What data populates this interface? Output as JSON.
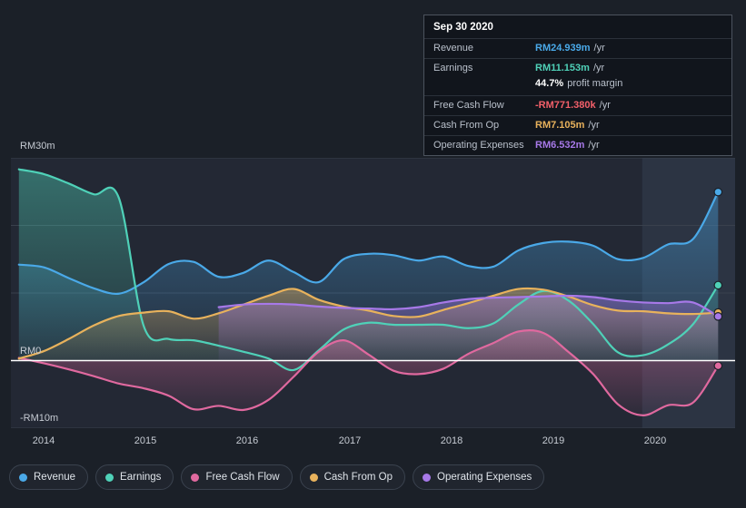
{
  "chart_data": {
    "type": "area",
    "title": "",
    "xlabel": "",
    "ylabel": "",
    "currency": "RM",
    "ylim": [
      -10,
      30
    ],
    "y_ticks": [
      {
        "value": 30,
        "label": "RM30m"
      },
      {
        "value": 20,
        "label": ""
      },
      {
        "value": 10,
        "label": ""
      },
      {
        "value": 0,
        "label": "RM0"
      },
      {
        "value": -10,
        "label": "-RM10m"
      }
    ],
    "x_ticks": [
      "2014",
      "2015",
      "2016",
      "2017",
      "2018",
      "2019",
      "2020"
    ],
    "xlim": [
      2013.7,
      2020.95
    ],
    "grid": true,
    "legend_position": "bottom",
    "series": [
      {
        "name": "Revenue",
        "color": "#4aa9e8",
        "x": [
          2013.78,
          2014.03,
          2014.28,
          2014.53,
          2014.78,
          2015.03,
          2015.28,
          2015.53,
          2015.78,
          2016.03,
          2016.28,
          2016.53,
          2016.78,
          2017.03,
          2017.28,
          2017.53,
          2017.78,
          2018.03,
          2018.28,
          2018.53,
          2018.78,
          2019.03,
          2019.28,
          2019.53,
          2019.78,
          2020.03,
          2020.28,
          2020.53,
          2020.78
        ],
        "values": [
          14.2,
          13.8,
          12.2,
          10.7,
          9.9,
          11.6,
          14.3,
          14.6,
          12.4,
          13.0,
          14.8,
          13.1,
          11.6,
          15.0,
          15.8,
          15.6,
          14.8,
          15.4,
          14.0,
          13.9,
          16.3,
          17.4,
          17.6,
          17.0,
          15.0,
          15.2,
          17.2,
          18.0,
          24.939
        ]
      },
      {
        "name": "Earnings",
        "color": "#4fd1b8",
        "x": [
          2013.78,
          2014.03,
          2014.28,
          2014.53,
          2014.78,
          2015.03,
          2015.28,
          2015.53,
          2015.78,
          2016.03,
          2016.28,
          2016.53,
          2016.78,
          2017.03,
          2017.28,
          2017.53,
          2017.78,
          2018.03,
          2018.28,
          2018.53,
          2018.78,
          2019.03,
          2019.28,
          2019.53,
          2019.78,
          2020.03,
          2020.28,
          2020.53,
          2020.78
        ],
        "values": [
          28.3,
          27.6,
          26.2,
          24.6,
          24.1,
          5.1,
          3.2,
          3.0,
          2.2,
          1.3,
          0.3,
          -1.4,
          1.5,
          4.6,
          5.6,
          5.3,
          5.3,
          5.3,
          4.8,
          5.5,
          8.3,
          10.3,
          8.9,
          5.4,
          1.2,
          0.8,
          2.4,
          5.4,
          11.153
        ]
      },
      {
        "name": "Free Cash Flow",
        "color": "#e0699f",
        "x": [
          2013.78,
          2014.03,
          2014.28,
          2014.53,
          2014.78,
          2015.03,
          2015.28,
          2015.53,
          2015.78,
          2016.03,
          2016.28,
          2016.53,
          2016.78,
          2017.03,
          2017.28,
          2017.53,
          2017.78,
          2018.03,
          2018.28,
          2018.53,
          2018.78,
          2019.03,
          2019.28,
          2019.53,
          2019.78,
          2020.03,
          2020.28,
          2020.53,
          2020.78
        ],
        "values": [
          0.4,
          -0.4,
          -1.3,
          -2.3,
          -3.4,
          -4.1,
          -5.2,
          -7.2,
          -6.7,
          -7.3,
          -5.8,
          -2.4,
          1.3,
          3.0,
          0.9,
          -1.5,
          -2.0,
          -1.2,
          1.0,
          2.6,
          4.3,
          4.1,
          1.3,
          -2.0,
          -6.5,
          -8.1,
          -6.6,
          -6.2,
          -0.771
        ]
      },
      {
        "name": "Cash From Op",
        "color": "#e8b25c",
        "x": [
          2013.78,
          2014.03,
          2014.28,
          2014.53,
          2014.78,
          2015.03,
          2015.28,
          2015.53,
          2015.78,
          2016.03,
          2016.28,
          2016.53,
          2016.78,
          2017.03,
          2017.28,
          2017.53,
          2017.78,
          2018.03,
          2018.28,
          2018.53,
          2018.78,
          2019.03,
          2019.28,
          2019.53,
          2019.78,
          2020.03,
          2020.28,
          2020.53,
          2020.78
        ],
        "values": [
          0.3,
          1.4,
          3.2,
          5.2,
          6.6,
          7.1,
          7.3,
          6.2,
          7.0,
          8.3,
          9.6,
          10.6,
          9.0,
          8.0,
          7.4,
          6.6,
          6.5,
          7.5,
          8.5,
          9.6,
          10.6,
          10.5,
          9.5,
          8.2,
          7.4,
          7.3,
          7.0,
          6.9,
          7.105
        ]
      },
      {
        "name": "Operating Expenses",
        "color": "#a779e8",
        "x": [
          2015.78,
          2016.03,
          2016.28,
          2016.53,
          2016.78,
          2017.03,
          2017.28,
          2017.53,
          2017.78,
          2018.03,
          2018.28,
          2018.53,
          2018.78,
          2019.03,
          2019.28,
          2019.53,
          2019.78,
          2020.03,
          2020.28,
          2020.53,
          2020.78
        ],
        "values": [
          7.9,
          8.3,
          8.4,
          8.3,
          8.0,
          7.8,
          7.7,
          7.6,
          7.9,
          8.6,
          9.1,
          9.3,
          9.4,
          9.5,
          9.6,
          9.4,
          8.9,
          8.6,
          8.5,
          8.6,
          6.532
        ]
      }
    ]
  },
  "tooltip": {
    "date": "Sep 30 2020",
    "rows": [
      {
        "name": "Revenue",
        "value": "RM24.939m",
        "unit": "/yr",
        "color": "#4aa9e8"
      },
      {
        "name": "Earnings",
        "value": "RM11.153m",
        "unit": "/yr",
        "color": "#4fd1b8",
        "sub_value": "44.7%",
        "sub_unit": "profit margin"
      },
      {
        "name": "Free Cash Flow",
        "value": "-RM771.380k",
        "unit": "/yr",
        "color": "#f4606a"
      },
      {
        "name": "Cash From Op",
        "value": "RM7.105m",
        "unit": "/yr",
        "color": "#e8b25c"
      },
      {
        "name": "Operating Expenses",
        "value": "RM6.532m",
        "unit": "/yr",
        "color": "#a779e8"
      }
    ]
  },
  "legend": {
    "items": [
      {
        "label": "Revenue",
        "color": "#4aa9e8"
      },
      {
        "label": "Earnings",
        "color": "#4fd1b8"
      },
      {
        "label": "Free Cash Flow",
        "color": "#e0699f"
      },
      {
        "label": "Cash From Op",
        "color": "#e8b25c"
      },
      {
        "label": "Operating Expenses",
        "color": "#a779e8"
      }
    ]
  }
}
